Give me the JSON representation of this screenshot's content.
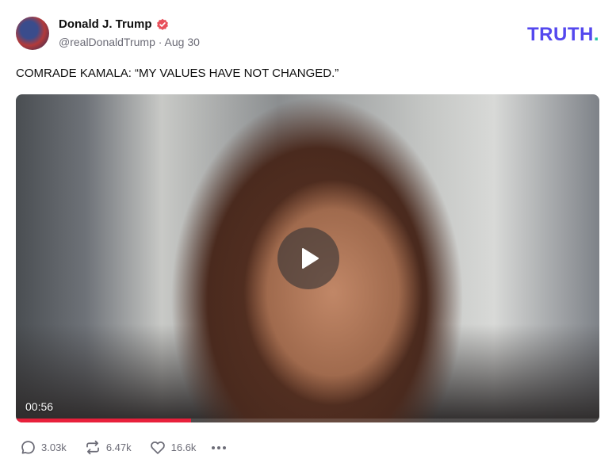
{
  "post": {
    "author_name": "Donald J. Trump",
    "handle": "@realDonaldTrump",
    "separator": "·",
    "date": "Aug 30",
    "text": "COMRADE KAMALA: “MY VALUES HAVE NOT CHANGED.”"
  },
  "brand": {
    "logo_text": "TRUTH",
    "logo_dot": ".",
    "logo_color": "#5448ee",
    "dot_color": "#22c5a1"
  },
  "video": {
    "duration": "00:56",
    "progress_fraction": 0.3,
    "progress_color": "#e8203b"
  },
  "actions": {
    "replies": "3.03k",
    "retruths": "6.47k",
    "likes": "16.6k"
  },
  "icons": [
    "verified-badge-icon",
    "play-icon",
    "reply-icon",
    "retruth-icon",
    "like-icon",
    "more-icon"
  ],
  "colors": {
    "verified": "#e8505b",
    "muted_text": "#6b6b76"
  }
}
